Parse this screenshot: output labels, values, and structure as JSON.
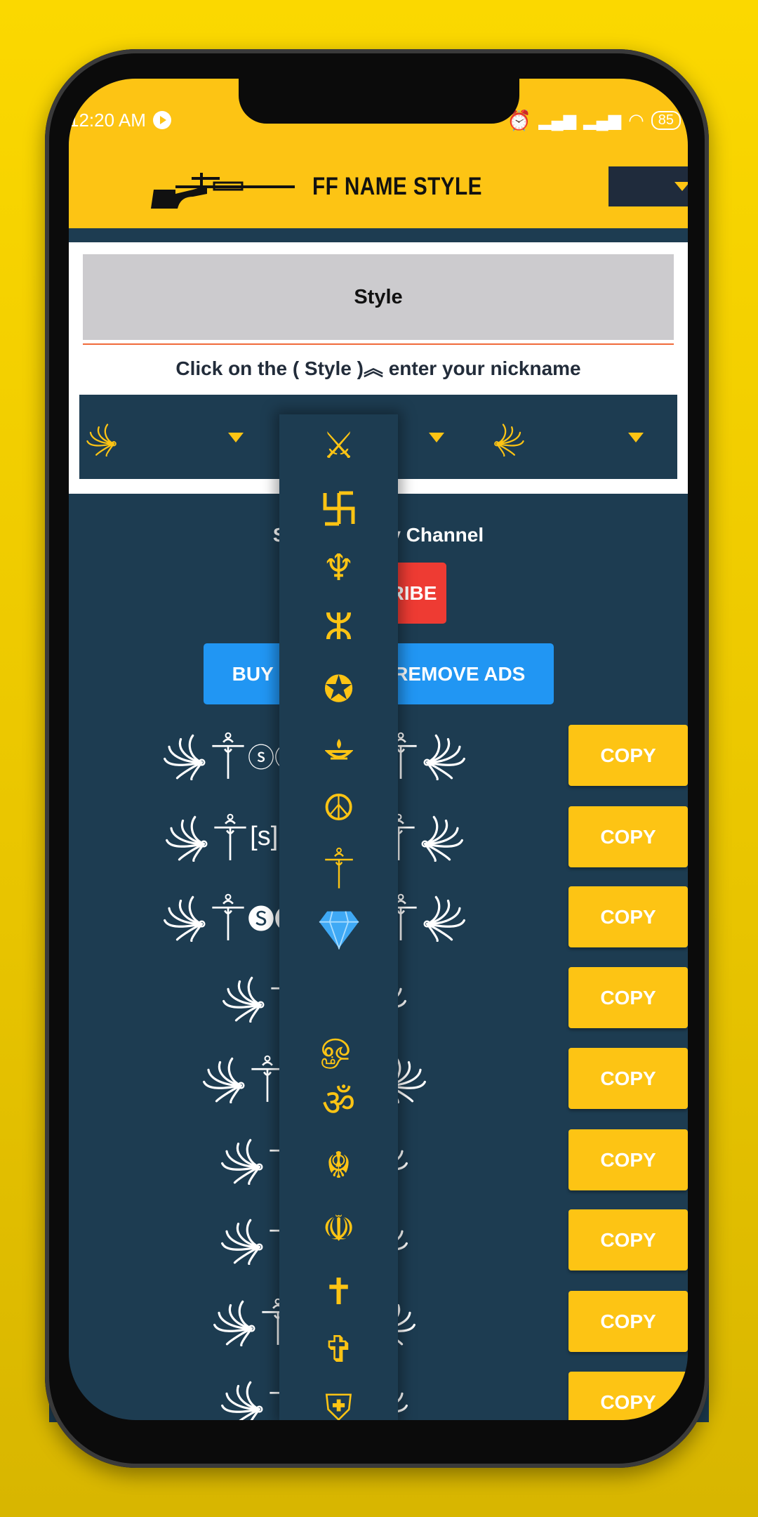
{
  "status_bar": {
    "time": "12:20 AM",
    "battery": "85"
  },
  "header": {
    "title": "FF NAME STYLE",
    "logo_icon": "sniper-rifle-icon"
  },
  "style_button": {
    "label": "Style"
  },
  "instruction": "Click on the ( Style )︽ enter your nickname",
  "selectors": [
    {
      "icon": "left-flourish"
    },
    {
      "icon": "crossed-swords"
    },
    {
      "icon": "right-flourish"
    }
  ],
  "subscribe": {
    "text": "Subscribe My Channel",
    "button": "SUBSCRIBE"
  },
  "premium_button": "BUY PREMIUM + REMOVE ADS",
  "rows": [
    {
      "name": "ⓢⓣⓨⓛⓔ",
      "copy": "COPY"
    },
    {
      "name": "[s][t][y][l][e]",
      "copy": "COPY"
    },
    {
      "name": "🅢🅣🅨🅛🅔",
      "copy": "COPY"
    },
    {
      "name": "ട",
      "copy": "COPY"
    },
    {
      "name": "style",
      "copy": "COPY"
    },
    {
      "name": "S",
      "copy": "COPY"
    },
    {
      "name": "S",
      "copy": "COPY"
    },
    {
      "name": "ST",
      "copy": "COPY"
    },
    {
      "name": "S",
      "copy": "COPY"
    }
  ],
  "symbol_menu": [
    "⚔",
    "卐",
    "♆",
    "ⵣ",
    "✪",
    "diya",
    "☮",
    "ornament",
    "diamond",
    "",
    "ௐ",
    "ॐ",
    "☬",
    "☫",
    "✝",
    "✞",
    "⛨"
  ],
  "colors": {
    "header": "#fdc414",
    "panel": "#1d3c51",
    "subscribe": "#ee3b33",
    "premium": "#2196f3",
    "copy": "#fdc414"
  }
}
